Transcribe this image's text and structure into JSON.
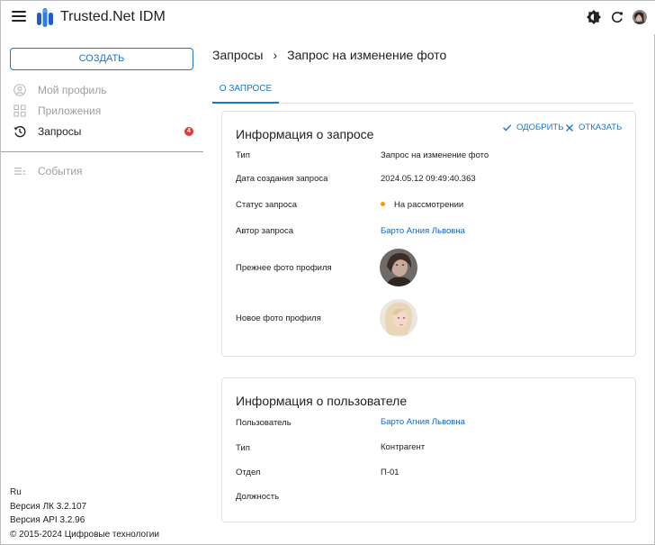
{
  "app": {
    "title": "Trusted.Net IDM"
  },
  "sidebar": {
    "create_label": "Создать",
    "items": [
      {
        "label": "Мой профиль",
        "icon": "account-circle-icon"
      },
      {
        "label": "Приложения",
        "icon": "apps-grid-icon"
      },
      {
        "label": "Запросы",
        "icon": "history-icon",
        "badge": "4"
      },
      {
        "label": "События",
        "icon": "list-icon"
      }
    ],
    "footer": {
      "lang": "Ru",
      "version_lk": "Версия ЛК 3.2.107",
      "version_api": "Версия API 3.2.96",
      "copyright": "© 2015-2024 Цифровые технологии"
    }
  },
  "breadcrumb": {
    "parent": "Запросы",
    "current": "Запрос на изменение фото"
  },
  "tabs": [
    {
      "label": "О запросе"
    }
  ],
  "request_card": {
    "title": "Информация о запросе",
    "approve_label": "Одобрить",
    "reject_label": "Отказать",
    "rows": {
      "type": {
        "label": "Тип",
        "value": "Запрос на изменение фото"
      },
      "created": {
        "label": "Дата создания запроса",
        "value": "2024.05.12 09:49:40.363"
      },
      "status": {
        "label": "Статус запроса",
        "value": "На рассмотрении"
      },
      "author": {
        "label": "Автор запроса",
        "value": "Барто Агния Львовна"
      },
      "old_photo": {
        "label": "Прежнее фото профиля"
      },
      "new_photo": {
        "label": "Новое фото профиля"
      }
    }
  },
  "user_card": {
    "title": "Информация о пользователе",
    "rows": {
      "user": {
        "label": "Пользователь",
        "value": "Барто Агния Львовна"
      },
      "type": {
        "label": "Тип",
        "value": "Контрагент"
      },
      "department": {
        "label": "Отдел",
        "value": "П-01"
      },
      "position": {
        "label": "Должность",
        "value": ""
      }
    }
  },
  "colors": {
    "accent": "#1976d2",
    "link": "#1565c0",
    "badge": "#e53935",
    "status_pending": "#ff9800"
  }
}
